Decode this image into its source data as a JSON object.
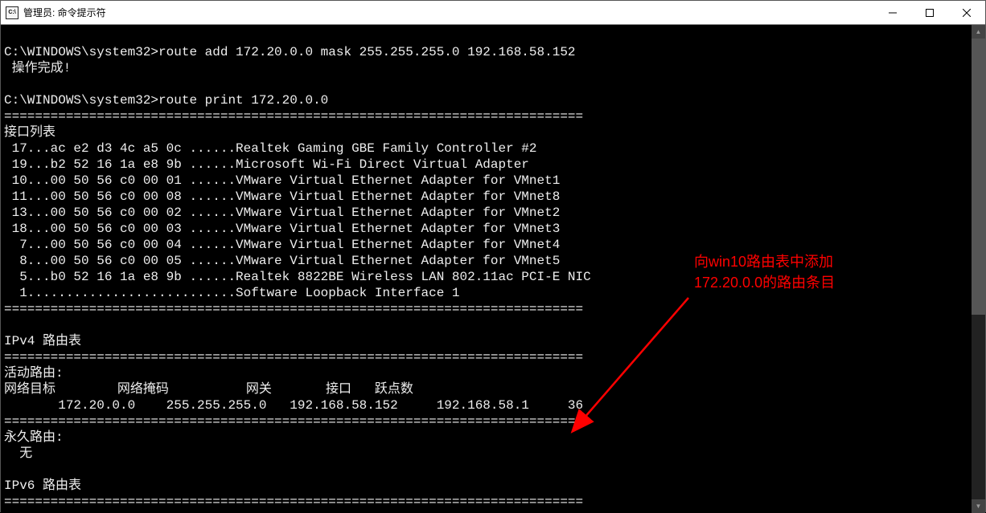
{
  "window": {
    "icon_text": "C:\\",
    "title": "管理员: 命令提示符"
  },
  "terminal": {
    "line01": "",
    "line02": "C:\\WINDOWS\\system32>route add 172.20.0.0 mask 255.255.255.0 192.168.58.152",
    "line03": " 操作完成!",
    "line04": "",
    "line05": "C:\\WINDOWS\\system32>route print 172.20.0.0",
    "line06": "===========================================================================",
    "line07": "接口列表",
    "line08": " 17...ac e2 d3 4c a5 0c ......Realtek Gaming GBE Family Controller #2",
    "line09": " 19...b2 52 16 1a e8 9b ......Microsoft Wi-Fi Direct Virtual Adapter",
    "line10": " 10...00 50 56 c0 00 01 ......VMware Virtual Ethernet Adapter for VMnet1",
    "line11": " 11...00 50 56 c0 00 08 ......VMware Virtual Ethernet Adapter for VMnet8",
    "line12": " 13...00 50 56 c0 00 02 ......VMware Virtual Ethernet Adapter for VMnet2",
    "line13": " 18...00 50 56 c0 00 03 ......VMware Virtual Ethernet Adapter for VMnet3",
    "line14": "  7...00 50 56 c0 00 04 ......VMware Virtual Ethernet Adapter for VMnet4",
    "line15": "  8...00 50 56 c0 00 05 ......VMware Virtual Ethernet Adapter for VMnet5",
    "line16": "  5...b0 52 16 1a e8 9b ......Realtek 8822BE Wireless LAN 802.11ac PCI-E NIC",
    "line17": "  1...........................Software Loopback Interface 1",
    "line18": "===========================================================================",
    "line19": "",
    "line20": "IPv4 路由表",
    "line21": "===========================================================================",
    "line22": "活动路由:",
    "line23": "网络目标        网络掩码          网关       接口   跃点数",
    "line24": "       172.20.0.0    255.255.255.0   192.168.58.152     192.168.58.1     36",
    "line25": "===========================================================================",
    "line26": "永久路由:",
    "line27": "  无",
    "line28": "",
    "line29": "IPv6 路由表",
    "line30": "==========================================================================="
  },
  "annotation": {
    "line1": "向win10路由表中添加",
    "line2": "172.20.0.0的路由条目"
  }
}
